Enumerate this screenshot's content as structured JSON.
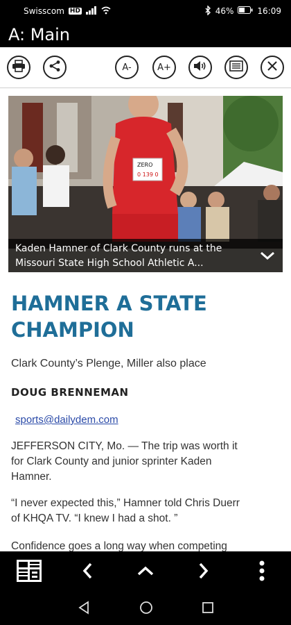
{
  "status": {
    "carrier": "Swisscom",
    "network_badge": "HD",
    "battery_percent": "46%",
    "time": "16:09"
  },
  "app": {
    "title": "A: Main"
  },
  "toolbar": {
    "font_smaller_label": "A-",
    "font_larger_label": "A+",
    "icons": [
      "print-icon",
      "share-icon",
      "font-smaller",
      "font-larger",
      "speaker-icon",
      "text-view-icon",
      "close-icon"
    ]
  },
  "article": {
    "photo_caption": "Kaden Hamner of Clark County runs at the Missouri State High School Athletic A...",
    "headline_line1": "HAMNER A STATE",
    "headline_line2": "CHAMPION",
    "subhead": "Clark County’s Plenge, Miller also place",
    "byline": "DOUG BRENNEMAN",
    "email": "sports@dailydem.com",
    "paragraph1_line1": "JEFFERSON CITY, Mo. — The trip was worth it",
    "paragraph1_line2": "for Clark County and junior sprinter Kaden",
    "paragraph1_line3": "Hamner.",
    "paragraph2_line1": "“I never expected this,” Hamner told Chris Duerr",
    "paragraph2_line2": "of KHQA TV. “I knew I had a shot. ”",
    "paragraph3_line1": "Confidence goes a long way when competing",
    "bib_brand": "ZERO",
    "bib_number": "0 139 0"
  },
  "colors": {
    "headline": "#1f6e98",
    "link": "#2a4aa8",
    "bar": "#000000"
  }
}
